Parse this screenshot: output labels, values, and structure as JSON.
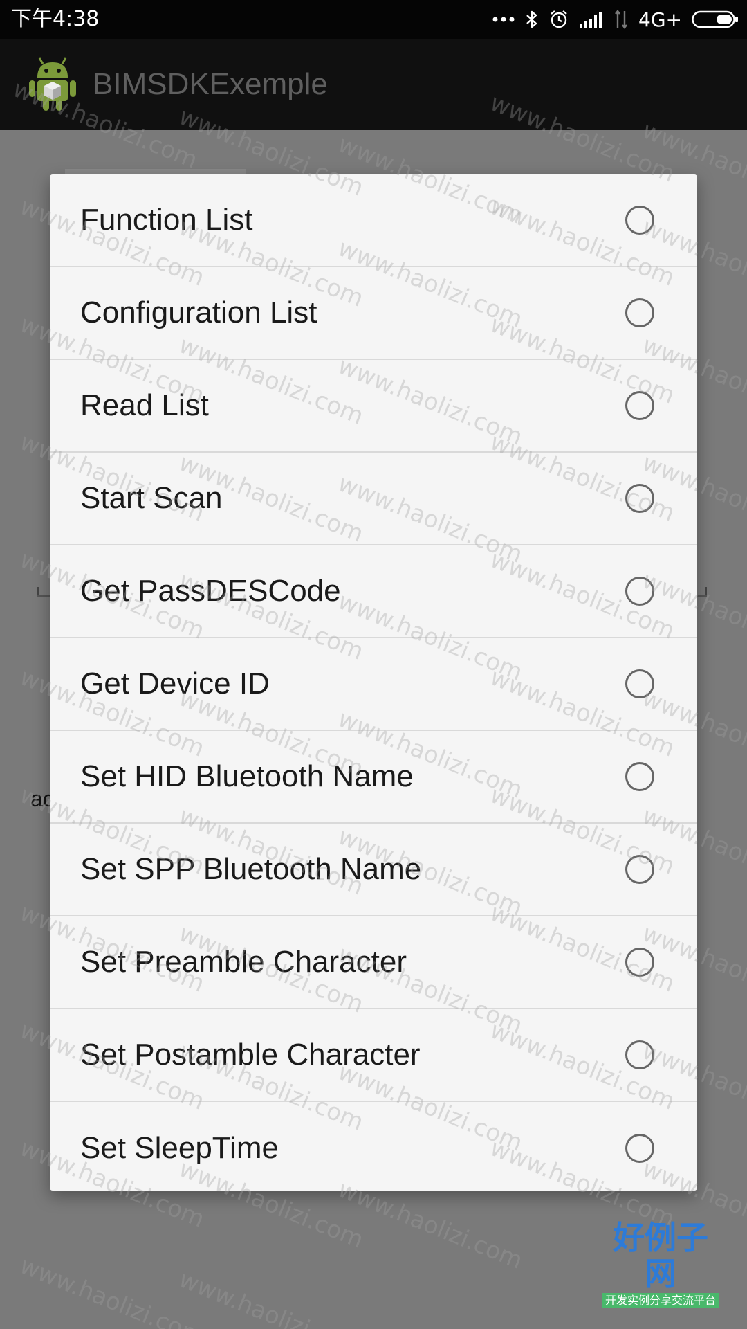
{
  "status_bar": {
    "time": "下午4:38",
    "network": "4G+",
    "icons": [
      "more-dots-icon",
      "bluetooth-icon",
      "alarm-icon",
      "signal-icon",
      "no-data-signal-icon",
      "battery-icon"
    ]
  },
  "app_bar": {
    "title": "BIMSDKExemple",
    "logo": "android-logo-icon"
  },
  "background": {
    "fragment_text": "ac"
  },
  "dialog": {
    "options": [
      {
        "label": "Function List",
        "checked": false
      },
      {
        "label": "Configuration List",
        "checked": false
      },
      {
        "label": "Read List",
        "checked": false
      },
      {
        "label": "Start Scan",
        "checked": false
      },
      {
        "label": "Get PassDESCode",
        "checked": false
      },
      {
        "label": "Get Device ID",
        "checked": false
      },
      {
        "label": "Set HID Bluetooth Name",
        "checked": false
      },
      {
        "label": "Set SPP Bluetooth Name",
        "checked": false
      },
      {
        "label": "Set Preamble Character",
        "checked": false
      },
      {
        "label": "Set Postamble Character",
        "checked": false
      },
      {
        "label": "Set SleepTime",
        "checked": false
      }
    ]
  },
  "watermark": {
    "text": "www.haolizi.com"
  },
  "brand": {
    "title": "好例子网",
    "subtitle": "开发实例分享交流平台"
  },
  "colors": {
    "status_bar": "#050505",
    "app_bar": "#101010",
    "overlay_background": "#7a7a7a",
    "dialog_background": "#f5f5f5",
    "divider": "#d9d9d9",
    "radio_border": "#666666",
    "brand_blue": "#2d7bd8",
    "brand_green": "#49b86b"
  }
}
